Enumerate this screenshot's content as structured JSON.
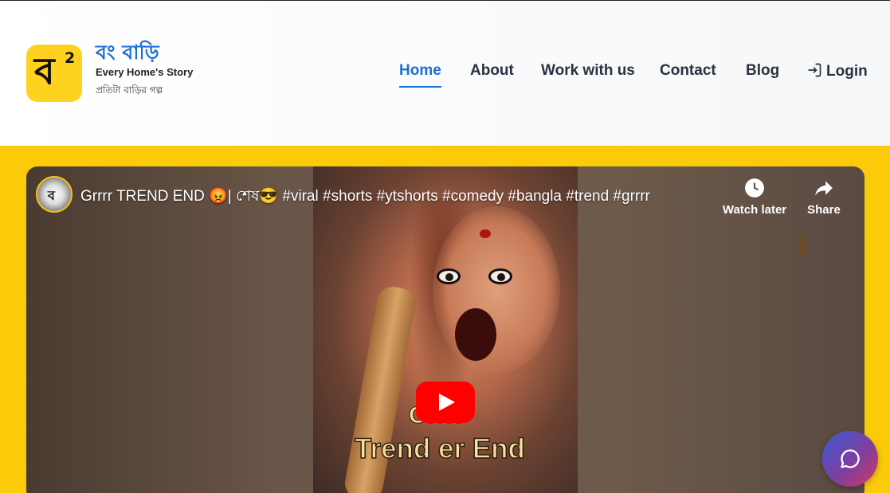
{
  "brand": {
    "logo_glyph": "ব",
    "logo_superscript": "2",
    "name": "বং বাড়ি",
    "tagline": "Every Home's Story",
    "subtagline": "প্রতিটা বাড়ির গল্প",
    "accent_color": "#1a6fd6",
    "logo_color": "#ffd21f"
  },
  "nav": {
    "items": [
      {
        "label": "Home",
        "active": true
      },
      {
        "label": "About",
        "active": false
      },
      {
        "label": "Work with us",
        "active": false
      },
      {
        "label": "Contact",
        "active": false
      },
      {
        "label": "Blog",
        "active": false
      }
    ],
    "login_label": "Login",
    "login_icon": "login-icon"
  },
  "video": {
    "title": "Grrrr TREND END 😡| শেষ😎 #viral #shorts #ytshorts #comedy #bangla #trend #grrrr",
    "watch_later_label": "Watch later",
    "share_label": "Share",
    "overlay_line1": "Grrrr",
    "overlay_line2": "Trend er End",
    "play_icon": "play-icon",
    "play_color": "#ff0000"
  },
  "chat": {
    "icon": "chat-icon"
  },
  "colors": {
    "band": "#fbcb0a",
    "nav_text": "#2a3140"
  }
}
